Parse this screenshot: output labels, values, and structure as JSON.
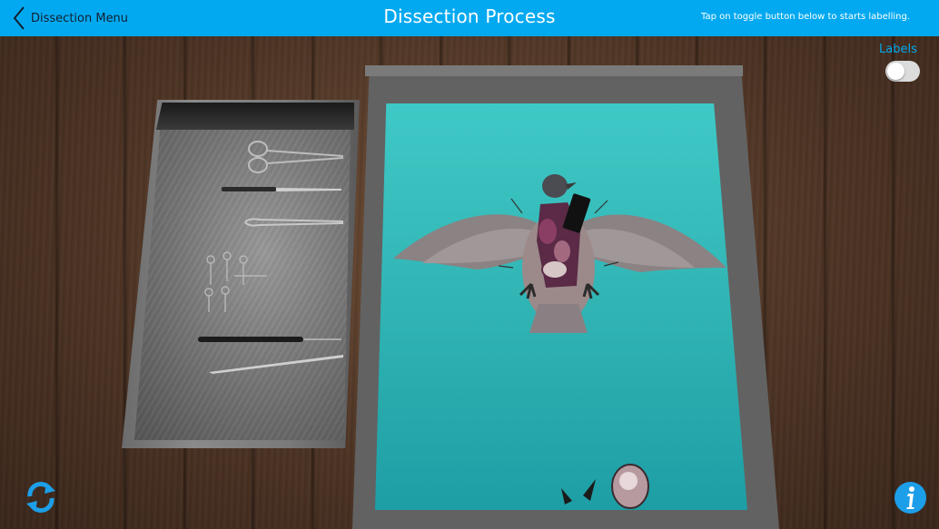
{
  "header": {
    "back_label": "Dissection Menu",
    "title": "Dissection Process",
    "hint": "Tap on toggle button below  to starts labelling."
  },
  "labels_toggle": {
    "label": "Labels",
    "state": "off"
  },
  "icons": {
    "back": "chevron-left-icon",
    "reset": "refresh-icon",
    "info": "info-icon"
  },
  "colors": {
    "header": "#03a9f0",
    "board_surface": "#2fb2b2",
    "accent": "#03a9f0"
  }
}
